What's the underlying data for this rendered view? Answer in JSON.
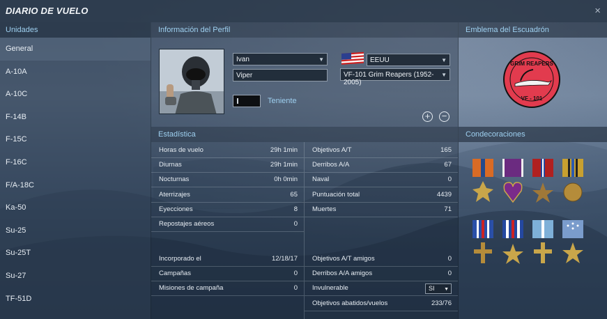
{
  "window": {
    "title": "DIARIO DE VUELO",
    "close_icon": "×"
  },
  "sidebar": {
    "header": "Unidades",
    "items": [
      {
        "label": "General",
        "selected": true
      },
      {
        "label": "A-10A"
      },
      {
        "label": "A-10C"
      },
      {
        "label": "F-14B"
      },
      {
        "label": "F-15C"
      },
      {
        "label": "F-16C"
      },
      {
        "label": "F/A-18C"
      },
      {
        "label": "Ka-50"
      },
      {
        "label": "Su-25"
      },
      {
        "label": "Su-25T"
      },
      {
        "label": "Su-27"
      },
      {
        "label": "TF-51D"
      }
    ]
  },
  "profile": {
    "header": "Información del Perfil",
    "name": "Ivan",
    "callsign": "Viper",
    "country": "EEUU",
    "squadron": "VF-101 Grim Reapers (1952-2005)",
    "rank": "Teniente",
    "add_icon": "+",
    "remove_icon": "−"
  },
  "emblem": {
    "header": "Emblema del Escuadrón",
    "top_text": "GRIM REAPERS",
    "bottom_text": "VF - 101"
  },
  "stats": {
    "header": "Estadística",
    "left": [
      {
        "label": "Horas de vuelo",
        "value": "29h 1min"
      },
      {
        "label": "Diurnas",
        "value": "29h 1min"
      },
      {
        "label": "Nocturnas",
        "value": "0h 0min"
      },
      {
        "label": "Aterrizajes",
        "value": "65"
      },
      {
        "label": "Eyecciones",
        "value": "8"
      },
      {
        "label": "Repostajes aéreos",
        "value": "0"
      }
    ],
    "right": [
      {
        "label": "Objetivos A/T",
        "value": "165"
      },
      {
        "label": "Derribos A/A",
        "value": "67"
      },
      {
        "label": "Naval",
        "value": "0"
      },
      {
        "label": "Puntuación total",
        "value": "4439"
      },
      {
        "label": "Muertes",
        "value": "71"
      }
    ],
    "left_bottom": [
      {
        "label": "Incorporado el",
        "value": "12/18/17"
      },
      {
        "label": "Campañas",
        "value": "0"
      },
      {
        "label": "Misiones de campaña",
        "value": "0"
      }
    ],
    "right_bottom": [
      {
        "label": "Objetivos A/T amigos",
        "value": "0"
      },
      {
        "label": "Derribos A/A amigos",
        "value": "0"
      },
      {
        "label": "Invulnerable",
        "value": "SI"
      },
      {
        "label": "Objetivos abatidos/vuelos",
        "value": "233/76"
      }
    ]
  },
  "decorations": {
    "header": "Condecoraciones"
  },
  "colors": {
    "accent": "#9ed0f0",
    "panel": "#263444"
  }
}
